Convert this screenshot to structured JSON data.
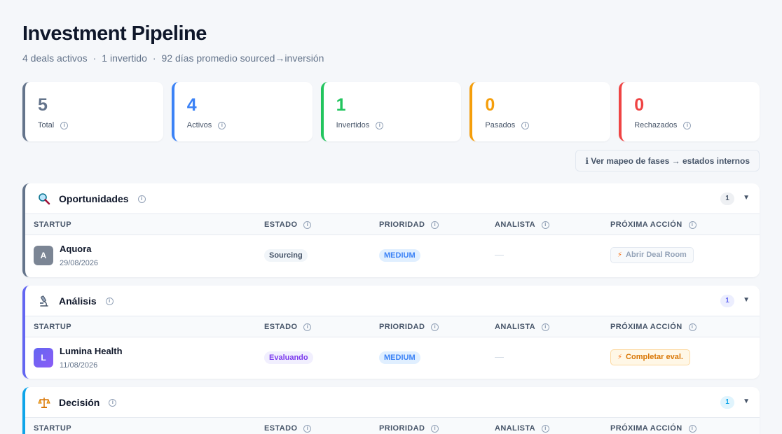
{
  "header": {
    "title": "Investment Pipeline",
    "summary": [
      "4 deals activos",
      "1 invertido",
      "92 días promedio sourced→inversión"
    ]
  },
  "stats": [
    {
      "value": "5",
      "label": "Total",
      "color": "#64748b"
    },
    {
      "value": "4",
      "label": "Activos",
      "color": "#3b82f6"
    },
    {
      "value": "1",
      "label": "Invertidos",
      "color": "#22c55e"
    },
    {
      "value": "0",
      "label": "Pasados",
      "color": "#f59e0b"
    },
    {
      "value": "0",
      "label": "Rechazados",
      "color": "#ef4444"
    }
  ],
  "map_button": "ℹ Ver mapeo de fases → estados internos",
  "columns": [
    "STARTUP",
    "ESTADO",
    "PRIORIDAD",
    "ANALISTA",
    "PRÓXIMA ACCIÓN"
  ],
  "sections": [
    {
      "name": "Oportunidades",
      "icon": "magnifier-icon",
      "count": "1",
      "accent": "#64748b",
      "rows": [
        {
          "initial": "A",
          "startup": "Aquora",
          "date": "29/08/2026",
          "estado": "Sourcing",
          "prioridad": "MEDIUM",
          "analista": "—",
          "action": "Abrir Deal Room",
          "action_style": "muted"
        }
      ]
    },
    {
      "name": "Análisis",
      "icon": "microscope-icon",
      "count": "1",
      "accent": "#6366f1",
      "rows": [
        {
          "initial": "L",
          "startup": "Lumina Health",
          "date": "11/08/2026",
          "estado": "Evaluando",
          "prioridad": "MEDIUM",
          "analista": "—",
          "action": "Completar eval.",
          "action_style": "warn"
        }
      ]
    },
    {
      "name": "Decisión",
      "icon": "balance-scale-icon",
      "count": "1",
      "accent": "#0ea5e9",
      "rows": []
    }
  ]
}
